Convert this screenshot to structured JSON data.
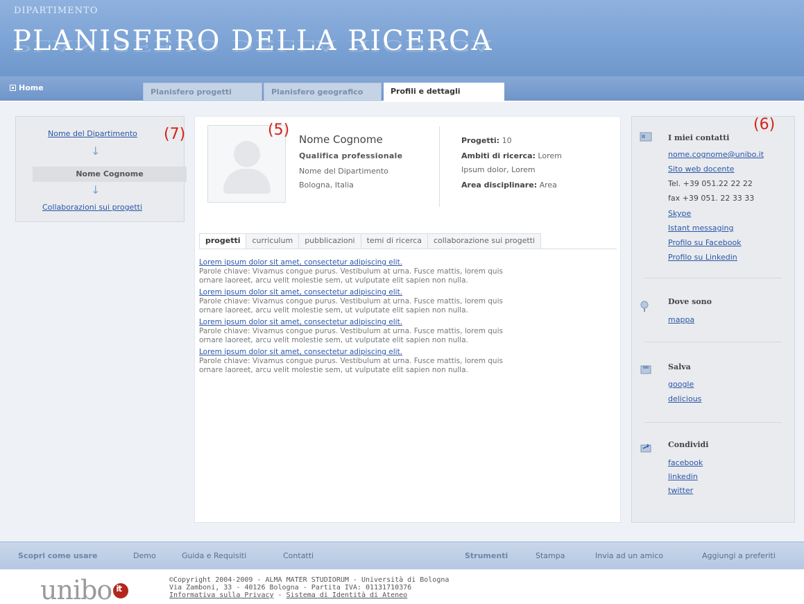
{
  "header": {
    "dept": "DIPARTIMENTO",
    "title": "PLANISFERO DELLA RICERCA"
  },
  "nav": {
    "home": "Home",
    "tabs": [
      {
        "label": "Planisfero progetti",
        "active": false
      },
      {
        "label": "Planisfero geografico",
        "active": false
      },
      {
        "label": "Profili e dettagli",
        "active": true
      }
    ]
  },
  "breadcrumb": {
    "dept_link": "Nome del Dipartimento",
    "arrow": "↓",
    "current": "Nome Cognome",
    "collab_link": "Collaborazioni sui progetti"
  },
  "annotations": {
    "left": "(7)",
    "center": "(5)",
    "right": "(6)"
  },
  "profile": {
    "name": "Nome Cognome",
    "qualifica": "Qualifica professionale",
    "dept": "Nome del Dipartimento",
    "city": "Bologna, Italia",
    "progetti_label": "Progetti:",
    "progetti_value": "10",
    "ambiti_label": "Ambiti di ricerca:",
    "ambiti_value": "Lorem",
    "ambiti_value2": "Ipsum dolor, Lorem",
    "area_label": "Area disciplinare:",
    "area_value": "Area"
  },
  "content_tabs": [
    {
      "label": "progetti",
      "active": true
    },
    {
      "label": "curriculum",
      "active": false
    },
    {
      "label": "pubblicazioni",
      "active": false
    },
    {
      "label": "temi di ricerca",
      "active": false
    },
    {
      "label": "collaborazione sui progetti",
      "active": false
    }
  ],
  "items": [
    {
      "title": "Lorem ipsum dolor sit amet, consectetur adipiscing elit.",
      "text1": "Parole chiave: Vivamus congue purus. Vestibulum at urna. Fusce mattis, lorem quis",
      "text2": "ornare laoreet, arcu velit molestie sem, ut vulputate elit sapien non nulla."
    },
    {
      "title": "Lorem ipsum dolor sit amet, consectetur adipiscing elit.",
      "text1": "Parole chiave: Vivamus congue purus. Vestibulum at urna. Fusce mattis, lorem quis",
      "text2": "ornare laoreet, arcu velit molestie sem, ut vulputate elit sapien non nulla."
    },
    {
      "title": "Lorem ipsum dolor sit amet, consectetur adipiscing elit.",
      "text1": "Parole chiave: Vivamus congue purus. Vestibulum at urna. Fusce mattis, lorem quis",
      "text2": "ornare laoreet, arcu velit molestie sem, ut vulputate elit sapien non nulla."
    },
    {
      "title": "Lorem ipsum dolor sit amet, consectetur adipiscing elit.",
      "text1": "Parole chiave: Vivamus congue purus. Vestibulum at urna. Fusce mattis, lorem quis",
      "text2": "ornare laoreet, arcu velit molestie sem, ut vulputate elit sapien non nulla."
    }
  ],
  "contacts": {
    "title": "I miei contatti",
    "email": "nome.cognome@unibo.it",
    "site": "Sito web docente",
    "tel": "Tel. +39 051.22 22 22",
    "fax": "fax +39 051. 22 33 33",
    "skype": "Skype",
    "im": "Istant messaging",
    "facebook": "Profilo su Facebook",
    "linkedin": "Profilo su Linkedin"
  },
  "where": {
    "title": "Dove sono",
    "map": "mappa"
  },
  "save": {
    "title": "Salva",
    "google": "google",
    "delicious": "delicious"
  },
  "share": {
    "title": "Condividi",
    "facebook": "facebook",
    "linkedin": "linkedin",
    "twitter": "twitter"
  },
  "footnav": {
    "discover": "Scopri come usare",
    "demo": "Demo",
    "guide": "Guida e Requisiti",
    "contacts": "Contatti",
    "tools": "Strumenti",
    "print": "Stampa",
    "send": "Invia ad un amico",
    "fav": "Aggiungi a preferiti"
  },
  "footer": {
    "logo_text": "unibo",
    "logo_it": "it",
    "copy1": "©Copyright 2004-2009 - ALMA MATER STUDIORUM - Università di Bologna",
    "copy2": "Via Zamboni, 33 - 40126 Bologna - Partita IVA: 01131710376",
    "privacy": "Informativa sulla Privacy",
    "sep": "-",
    "identity": "Sistema di Identità di Ateneo"
  },
  "colors": {
    "header_blue": "#7ba2d4",
    "link_blue": "#2a56a8",
    "annotation_red": "#d3231a"
  }
}
